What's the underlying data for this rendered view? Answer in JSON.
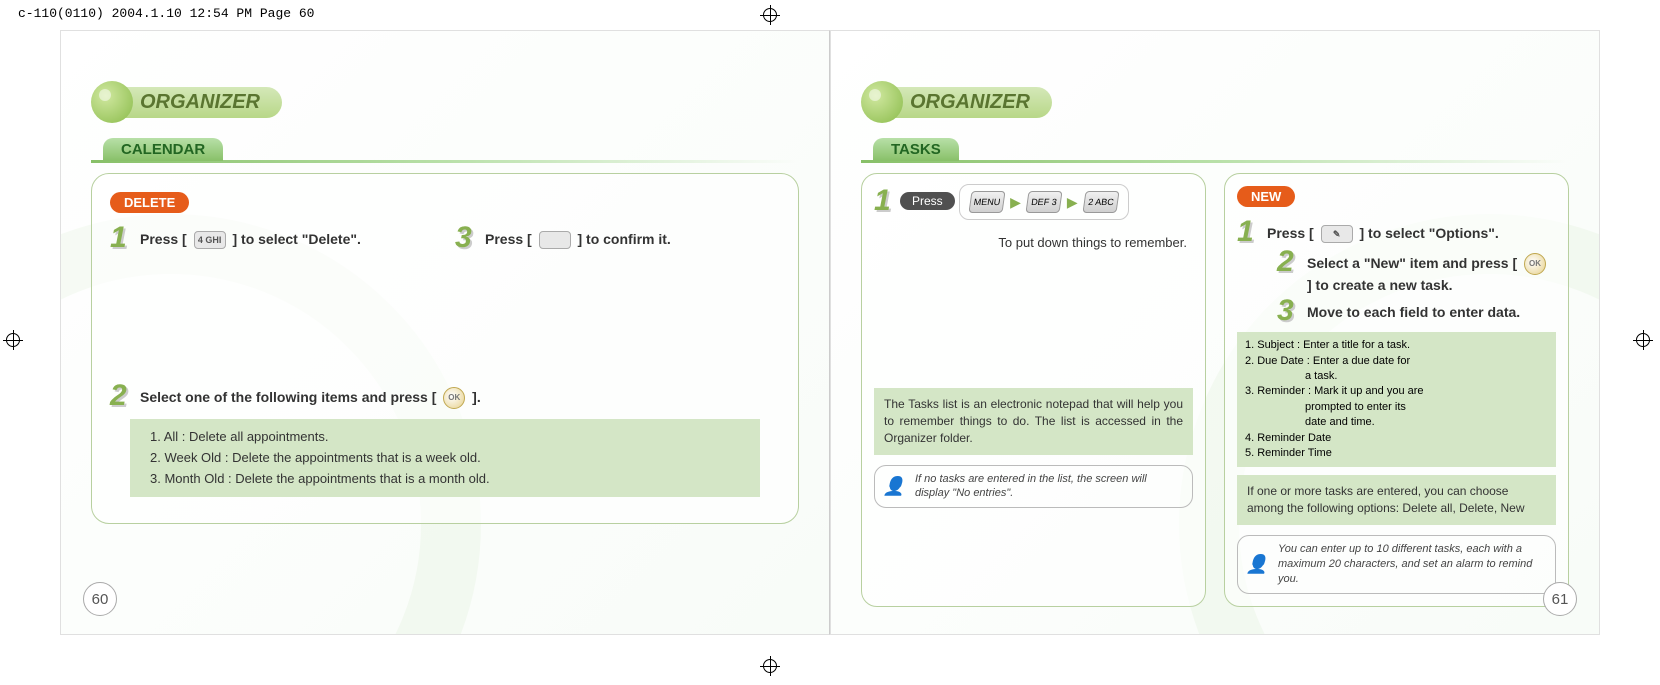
{
  "header_info": "c-110(0110)  2004.1.10  12:54 PM  Page 60",
  "left": {
    "section_title": "ORGANIZER",
    "subsection": "CALENDAR",
    "badge": "DELETE",
    "step1_pre": "Press [ ",
    "step1_key": "4 GHI",
    "step1_post": " ] to select \"Delete\".",
    "step3_pre": "Press [ ",
    "step3_post": " ] to confirm it.",
    "step2_pre": "Select one of the following items and press [ ",
    "step2_key": "OK",
    "step2_post": " ].",
    "items": {
      "i1": "1. All : Delete all appointments.",
      "i2": "2. Week Old : Delete the appointments that is a week old.",
      "i3": "3. Month Old : Delete the appointments that is a month old."
    },
    "page_num": "60"
  },
  "right": {
    "section_title": "ORGANIZER",
    "subsection": "TASKS",
    "press_label": "Press",
    "keys": {
      "k1": "MENU",
      "k2": "DEF 3",
      "k3": "2 ABC"
    },
    "caption": "To put down things to remember.",
    "tasks_desc": "The Tasks list is an electronic notepad that will help you to remember things to do. The list is accessed in the Organizer folder.",
    "note1": "If no tasks are entered in the list, the screen will display \"No entries\".",
    "new_badge": "NEW",
    "new1_pre": "Press [ ",
    "new1_post": " ] to select \"Options\".",
    "new2_pre": "Select a \"New\" item and press [ ",
    "new2_key": "OK",
    "new2_post": " ] to create a new task.",
    "new3": "Move to each field to enter data.",
    "fields": {
      "f1": "1. Subject : Enter a title for a task.",
      "f2": "2. Due Date : Enter a due date for",
      "f2b": "a task.",
      "f3": "3. Reminder : Mark it up and you are",
      "f3b": "prompted to enter its",
      "f3c": "date and time.",
      "f4": "4. Reminder Date",
      "f5": "5. Reminder Time"
    },
    "options_note": "If one or more tasks are entered, you can choose among the following options: Delete all, Delete, New",
    "note2": "You can enter up to 10 different tasks, each with a maximum 20 characters, and set an alarm to remind you.",
    "page_num": "61"
  }
}
